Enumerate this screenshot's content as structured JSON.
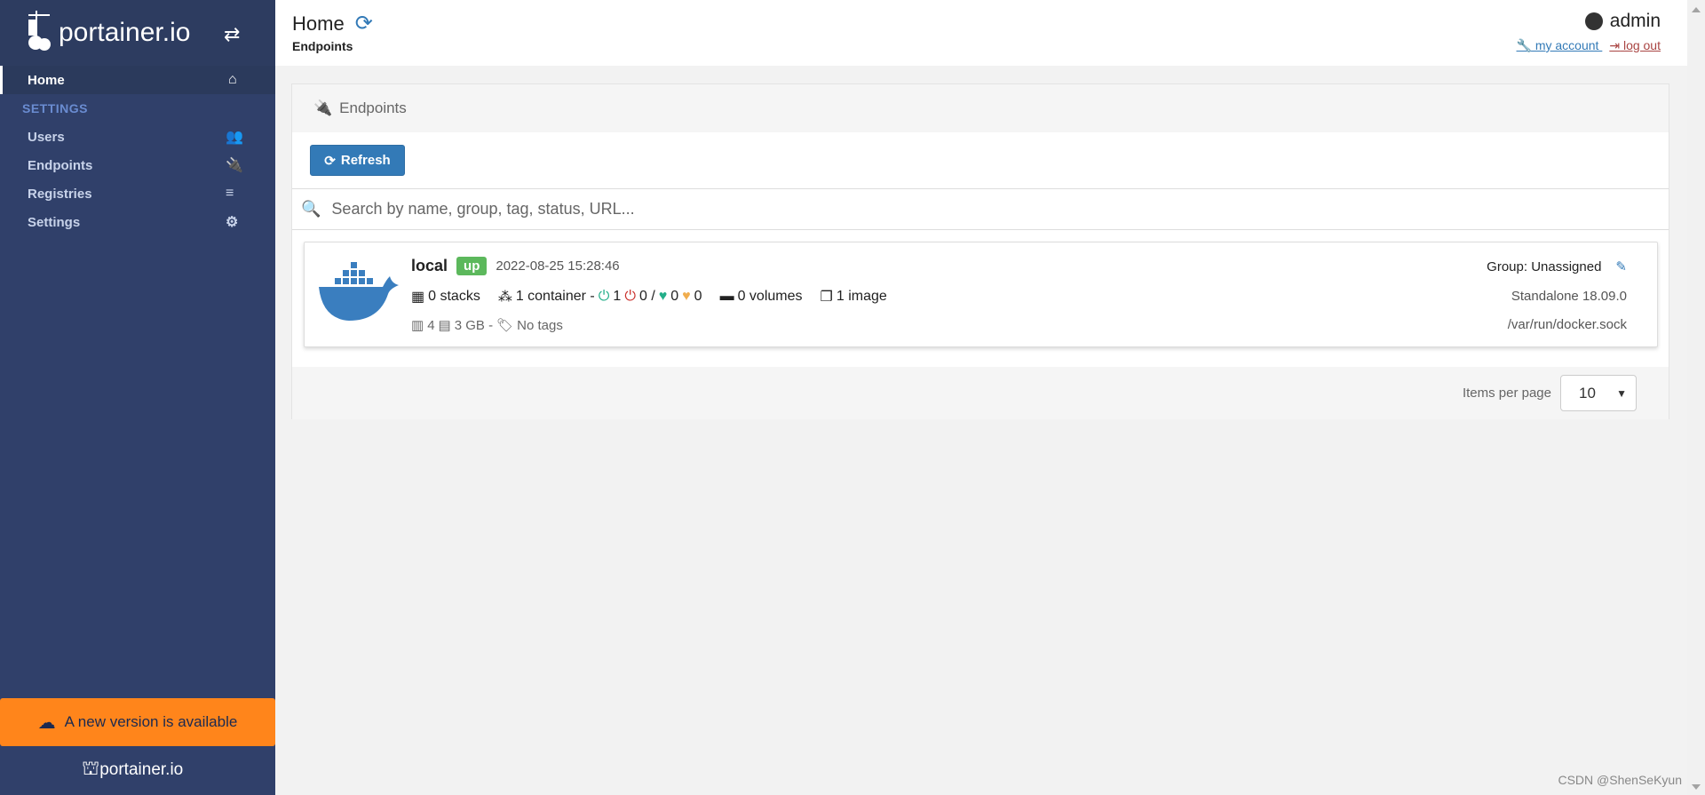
{
  "sidebar": {
    "brand": "portainer.io",
    "items": [
      {
        "label": "Home",
        "icon": "home-icon"
      }
    ],
    "section_title": "SETTINGS",
    "settings_items": [
      {
        "label": "Users",
        "icon": "users-icon"
      },
      {
        "label": "Endpoints",
        "icon": "plug-icon"
      },
      {
        "label": "Registries",
        "icon": "database-icon"
      },
      {
        "label": "Settings",
        "icon": "cogs-icon"
      }
    ],
    "update_banner": "A new version is available",
    "footer_brand": "portainer.io"
  },
  "header": {
    "title": "Home",
    "breadcrumb": "Endpoints",
    "user": "admin",
    "my_account": " my account ",
    "log_out": " log out"
  },
  "panel": {
    "title": "Endpoints",
    "refresh_label": "Refresh",
    "search_placeholder": "Search by name, group, tag, status, URL...",
    "endpoints": [
      {
        "name": "local",
        "status": "up",
        "timestamp": "2022-08-25 15:28:46",
        "stacks": "0 stacks",
        "containers": "1 container -",
        "running": "1",
        "stopped": "0 /",
        "healthy": "0",
        "unhealthy": "0",
        "volumes": "0 volumes",
        "images": "1 image",
        "cpu": "4",
        "memory": "3 GB -",
        "tags": "No tags",
        "group": "Group: Unassigned",
        "engine": "Standalone 18.09.0",
        "url": "/var/run/docker.sock"
      }
    ],
    "items_per_page_label": "Items per page",
    "items_per_page": "10"
  },
  "watermark": "CSDN @ShenSeKyun",
  "colors": {
    "sidebar": "#30406a",
    "primary": "#337ab7",
    "success": "#5cb85c",
    "banner": "#ff851b"
  }
}
